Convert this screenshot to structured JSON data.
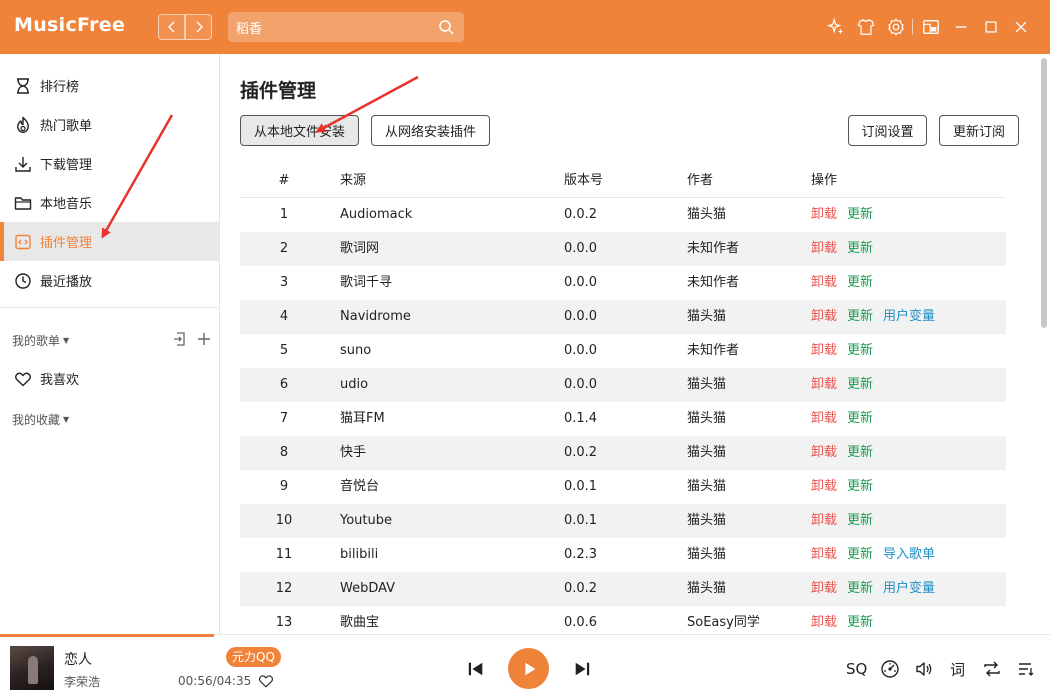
{
  "app": {
    "name": "MusicFree",
    "accent": "#F0833A"
  },
  "search": {
    "value": "稻香",
    "icon": "search-icon"
  },
  "header_icons": [
    "skin-sparkle-icon",
    "shirt-icon",
    "settings-gear-icon",
    "mini-mode-icon",
    "minimize-icon",
    "maximize-icon",
    "close-icon"
  ],
  "sidebar": {
    "items": [
      {
        "label": "排行榜",
        "icon": "hourglass-icon"
      },
      {
        "label": "热门歌单",
        "icon": "flame-icon"
      },
      {
        "label": "下载管理",
        "icon": "download-icon"
      },
      {
        "label": "本地音乐",
        "icon": "folder-icon"
      },
      {
        "label": "插件管理",
        "icon": "plugin-code-icon",
        "active": true
      },
      {
        "label": "最近播放",
        "icon": "clock-icon"
      }
    ],
    "my_playlists": "我的歌单",
    "favorites": "我喜欢",
    "my_collections": "我的收藏"
  },
  "main": {
    "title": "插件管理",
    "buttons": {
      "install_local": "从本地文件安装",
      "install_network": "从网络安装插件",
      "subscribe_settings": "订阅设置",
      "update_subscriptions": "更新订阅"
    },
    "table": {
      "headers": [
        "#",
        "来源",
        "版本号",
        "作者",
        "操作"
      ],
      "ops": {
        "uninstall": "卸载",
        "update": "更新"
      },
      "rows": [
        {
          "idx": "1",
          "source": "Audiomack",
          "version": "0.0.2",
          "author": "猫头猫",
          "extra": ""
        },
        {
          "idx": "2",
          "source": "歌词网",
          "version": "0.0.0",
          "author": "未知作者",
          "extra": ""
        },
        {
          "idx": "3",
          "source": "歌词千寻",
          "version": "0.0.0",
          "author": "未知作者",
          "extra": ""
        },
        {
          "idx": "4",
          "source": "Navidrome",
          "version": "0.0.0",
          "author": "猫头猫",
          "extra": "用户变量"
        },
        {
          "idx": "5",
          "source": "suno",
          "version": "0.0.0",
          "author": "未知作者",
          "extra": ""
        },
        {
          "idx": "6",
          "source": "udio",
          "version": "0.0.0",
          "author": "猫头猫",
          "extra": ""
        },
        {
          "idx": "7",
          "source": "猫耳FM",
          "version": "0.1.4",
          "author": "猫头猫",
          "extra": ""
        },
        {
          "idx": "8",
          "source": "快手",
          "version": "0.0.2",
          "author": "猫头猫",
          "extra": ""
        },
        {
          "idx": "9",
          "source": "音悦台",
          "version": "0.0.1",
          "author": "猫头猫",
          "extra": ""
        },
        {
          "idx": "10",
          "source": "Youtube",
          "version": "0.0.1",
          "author": "猫头猫",
          "extra": ""
        },
        {
          "idx": "11",
          "source": "bilibili",
          "version": "0.2.3",
          "author": "猫头猫",
          "extra": "导入歌单"
        },
        {
          "idx": "12",
          "source": "WebDAV",
          "version": "0.0.2",
          "author": "猫头猫",
          "extra": "用户变量"
        },
        {
          "idx": "13",
          "source": "歌曲宝",
          "version": "0.0.6",
          "author": "SoEasy同学",
          "extra": ""
        }
      ]
    }
  },
  "player": {
    "title": "恋人",
    "artist": "李荣浩",
    "source": "元力QQ",
    "time": "00:56/04:35",
    "progress": 0.204,
    "quality": "SQ",
    "lyric": "词"
  }
}
